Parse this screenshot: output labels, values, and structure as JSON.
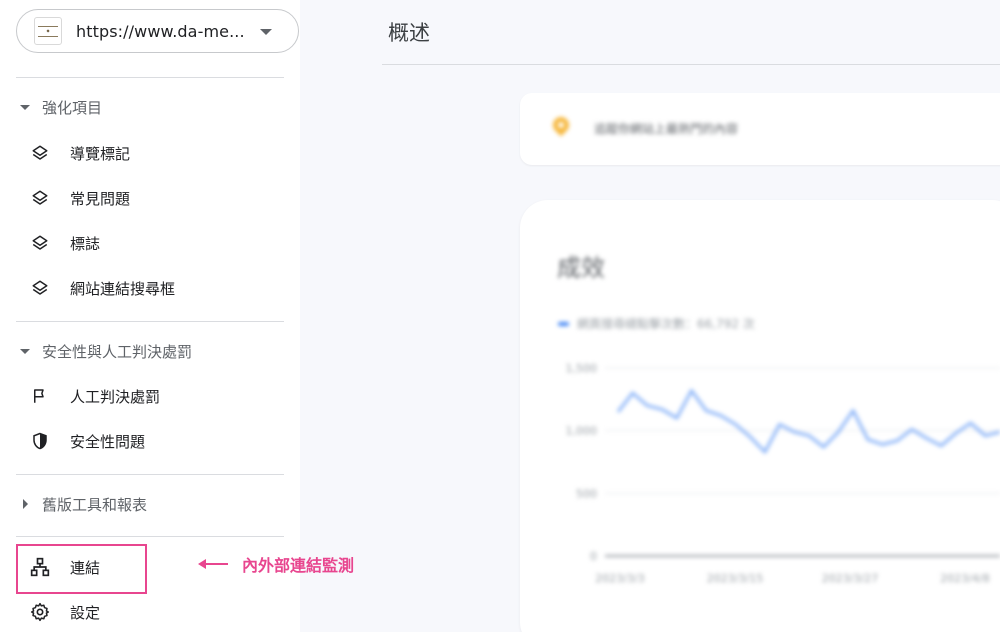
{
  "property": {
    "url": "https://www.da-me..."
  },
  "sidebar": {
    "sections": [
      {
        "title": "強化項目",
        "items": [
          {
            "label": "導覽標記",
            "icon": "layers-icon"
          },
          {
            "label": "常見問題",
            "icon": "layers-icon"
          },
          {
            "label": "標誌",
            "icon": "layers-icon"
          },
          {
            "label": "網站連結搜尋框",
            "icon": "layers-icon"
          }
        ]
      },
      {
        "title": "安全性與人工判決處罰",
        "items": [
          {
            "label": "人工判決處罰",
            "icon": "flag-icon"
          },
          {
            "label": "安全性問題",
            "icon": "shield-icon"
          }
        ]
      },
      {
        "title": "舊版工具和報表",
        "collapsed": true
      }
    ],
    "links_label": "連結",
    "settings_label": "設定"
  },
  "annotation": {
    "text": "內外部連結監測",
    "color": "#e8468f"
  },
  "header": {
    "title": "概述"
  },
  "tip": {
    "text": "追蹤你網站上最熱門的內容"
  },
  "performance": {
    "title": "成效",
    "legend": "網頁搜尋總點擊次數：66,792 次"
  },
  "chart_data": {
    "type": "line",
    "series": [
      {
        "name": "網頁搜尋總點擊次數：66,792 次",
        "color": "#4285f4",
        "values": [
          1150,
          1300,
          1200,
          1170,
          1100,
          1320,
          1160,
          1120,
          1050,
          950,
          830,
          1050,
          990,
          960,
          870,
          990,
          1160,
          930,
          890,
          920,
          1010,
          940,
          880,
          980,
          1060,
          960,
          990
        ]
      }
    ],
    "ylim": [
      0,
      1500
    ],
    "y_ticks": [
      "1,500",
      "1,000",
      "500",
      "0"
    ],
    "x_ticks": [
      "2023/3/3",
      "2023/3/15",
      "2023/3/27",
      "2023/4/8"
    ]
  }
}
